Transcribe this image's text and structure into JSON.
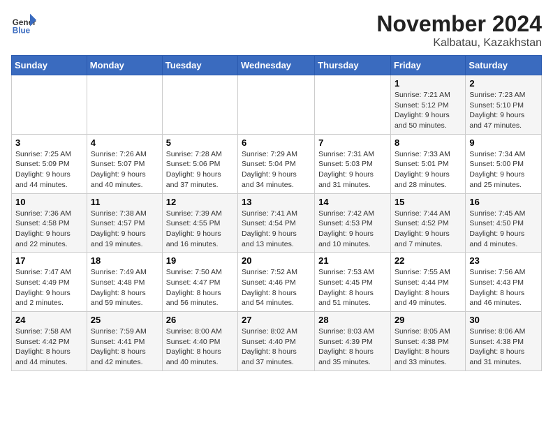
{
  "header": {
    "logo_general": "General",
    "logo_blue": "Blue",
    "month_title": "November 2024",
    "location": "Kalbatau, Kazakhstan"
  },
  "days_of_week": [
    "Sunday",
    "Monday",
    "Tuesday",
    "Wednesday",
    "Thursday",
    "Friday",
    "Saturday"
  ],
  "weeks": [
    [
      {
        "day": "",
        "info": ""
      },
      {
        "day": "",
        "info": ""
      },
      {
        "day": "",
        "info": ""
      },
      {
        "day": "",
        "info": ""
      },
      {
        "day": "",
        "info": ""
      },
      {
        "day": "1",
        "info": "Sunrise: 7:21 AM\nSunset: 5:12 PM\nDaylight: 9 hours and 50 minutes."
      },
      {
        "day": "2",
        "info": "Sunrise: 7:23 AM\nSunset: 5:10 PM\nDaylight: 9 hours and 47 minutes."
      }
    ],
    [
      {
        "day": "3",
        "info": "Sunrise: 7:25 AM\nSunset: 5:09 PM\nDaylight: 9 hours and 44 minutes."
      },
      {
        "day": "4",
        "info": "Sunrise: 7:26 AM\nSunset: 5:07 PM\nDaylight: 9 hours and 40 minutes."
      },
      {
        "day": "5",
        "info": "Sunrise: 7:28 AM\nSunset: 5:06 PM\nDaylight: 9 hours and 37 minutes."
      },
      {
        "day": "6",
        "info": "Sunrise: 7:29 AM\nSunset: 5:04 PM\nDaylight: 9 hours and 34 minutes."
      },
      {
        "day": "7",
        "info": "Sunrise: 7:31 AM\nSunset: 5:03 PM\nDaylight: 9 hours and 31 minutes."
      },
      {
        "day": "8",
        "info": "Sunrise: 7:33 AM\nSunset: 5:01 PM\nDaylight: 9 hours and 28 minutes."
      },
      {
        "day": "9",
        "info": "Sunrise: 7:34 AM\nSunset: 5:00 PM\nDaylight: 9 hours and 25 minutes."
      }
    ],
    [
      {
        "day": "10",
        "info": "Sunrise: 7:36 AM\nSunset: 4:58 PM\nDaylight: 9 hours and 22 minutes."
      },
      {
        "day": "11",
        "info": "Sunrise: 7:38 AM\nSunset: 4:57 PM\nDaylight: 9 hours and 19 minutes."
      },
      {
        "day": "12",
        "info": "Sunrise: 7:39 AM\nSunset: 4:55 PM\nDaylight: 9 hours and 16 minutes."
      },
      {
        "day": "13",
        "info": "Sunrise: 7:41 AM\nSunset: 4:54 PM\nDaylight: 9 hours and 13 minutes."
      },
      {
        "day": "14",
        "info": "Sunrise: 7:42 AM\nSunset: 4:53 PM\nDaylight: 9 hours and 10 minutes."
      },
      {
        "day": "15",
        "info": "Sunrise: 7:44 AM\nSunset: 4:52 PM\nDaylight: 9 hours and 7 minutes."
      },
      {
        "day": "16",
        "info": "Sunrise: 7:45 AM\nSunset: 4:50 PM\nDaylight: 9 hours and 4 minutes."
      }
    ],
    [
      {
        "day": "17",
        "info": "Sunrise: 7:47 AM\nSunset: 4:49 PM\nDaylight: 9 hours and 2 minutes."
      },
      {
        "day": "18",
        "info": "Sunrise: 7:49 AM\nSunset: 4:48 PM\nDaylight: 8 hours and 59 minutes."
      },
      {
        "day": "19",
        "info": "Sunrise: 7:50 AM\nSunset: 4:47 PM\nDaylight: 8 hours and 56 minutes."
      },
      {
        "day": "20",
        "info": "Sunrise: 7:52 AM\nSunset: 4:46 PM\nDaylight: 8 hours and 54 minutes."
      },
      {
        "day": "21",
        "info": "Sunrise: 7:53 AM\nSunset: 4:45 PM\nDaylight: 8 hours and 51 minutes."
      },
      {
        "day": "22",
        "info": "Sunrise: 7:55 AM\nSunset: 4:44 PM\nDaylight: 8 hours and 49 minutes."
      },
      {
        "day": "23",
        "info": "Sunrise: 7:56 AM\nSunset: 4:43 PM\nDaylight: 8 hours and 46 minutes."
      }
    ],
    [
      {
        "day": "24",
        "info": "Sunrise: 7:58 AM\nSunset: 4:42 PM\nDaylight: 8 hours and 44 minutes."
      },
      {
        "day": "25",
        "info": "Sunrise: 7:59 AM\nSunset: 4:41 PM\nDaylight: 8 hours and 42 minutes."
      },
      {
        "day": "26",
        "info": "Sunrise: 8:00 AM\nSunset: 4:40 PM\nDaylight: 8 hours and 40 minutes."
      },
      {
        "day": "27",
        "info": "Sunrise: 8:02 AM\nSunset: 4:40 PM\nDaylight: 8 hours and 37 minutes."
      },
      {
        "day": "28",
        "info": "Sunrise: 8:03 AM\nSunset: 4:39 PM\nDaylight: 8 hours and 35 minutes."
      },
      {
        "day": "29",
        "info": "Sunrise: 8:05 AM\nSunset: 4:38 PM\nDaylight: 8 hours and 33 minutes."
      },
      {
        "day": "30",
        "info": "Sunrise: 8:06 AM\nSunset: 4:38 PM\nDaylight: 8 hours and 31 minutes."
      }
    ]
  ]
}
